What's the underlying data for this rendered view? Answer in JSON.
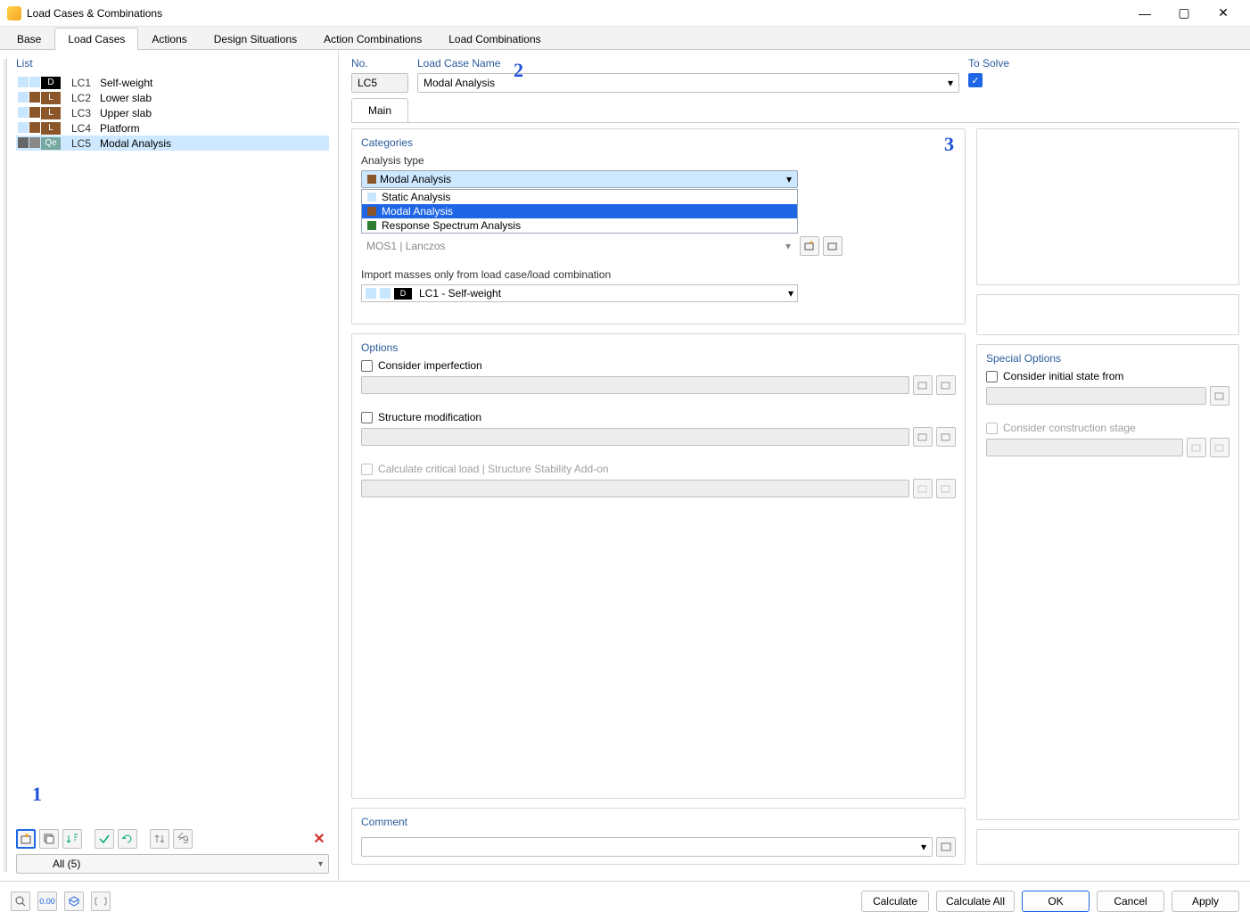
{
  "window": {
    "title": "Load Cases & Combinations"
  },
  "tabs": [
    "Base",
    "Load Cases",
    "Actions",
    "Design Situations",
    "Action Combinations",
    "Load Combinations"
  ],
  "active_tab": 1,
  "sidebar": {
    "label": "List",
    "items": [
      {
        "badge": "D",
        "badge_cls": "c-black",
        "code": "LC1",
        "name": "Self-weight"
      },
      {
        "badge": "L",
        "badge_cls": "c-brown",
        "code": "LC2",
        "name": "Lower slab"
      },
      {
        "badge": "L",
        "badge_cls": "c-brown",
        "code": "LC3",
        "name": "Upper slab"
      },
      {
        "badge": "L",
        "badge_cls": "c-brown",
        "code": "LC4",
        "name": "Platform"
      },
      {
        "badge": "Qe",
        "badge_cls": "c-teal",
        "code": "LC5",
        "name": "Modal Analysis",
        "selected": true
      }
    ],
    "filter": "All (5)"
  },
  "header": {
    "no_label": "No.",
    "no_value": "LC5",
    "name_label": "Load Case Name",
    "name_value": "Modal Analysis",
    "solve_label": "To Solve",
    "solve_checked": true
  },
  "main_tab": "Main",
  "categories": {
    "title": "Categories",
    "analysis_type_label": "Analysis type",
    "selected": "Modal Analysis",
    "options": [
      {
        "label": "Static Analysis",
        "swatch": "#c8e6ff"
      },
      {
        "label": "Modal Analysis",
        "swatch": "#8b572a",
        "highlight": true
      },
      {
        "label": "Response Spectrum Analysis",
        "swatch": "#2e7d32"
      }
    ],
    "hidden_row": "MOS1    |  Lanczos",
    "import_label": "Import masses only from load case/load combination",
    "import_value": "LC1 - Self-weight"
  },
  "options": {
    "title": "Options",
    "consider_imperfection": "Consider imperfection",
    "structure_modification": "Structure modification",
    "critical_load": "Calculate critical load | Structure Stability Add-on"
  },
  "special": {
    "title": "Special Options",
    "initial_state": "Consider initial state from",
    "construction_stage": "Consider construction stage"
  },
  "comment": {
    "title": "Comment"
  },
  "footer": {
    "calculate": "Calculate",
    "calculate_all": "Calculate All",
    "ok": "OK",
    "cancel": "Cancel",
    "apply": "Apply"
  },
  "annotations": {
    "n1": "1",
    "n2": "2",
    "n3": "3"
  }
}
